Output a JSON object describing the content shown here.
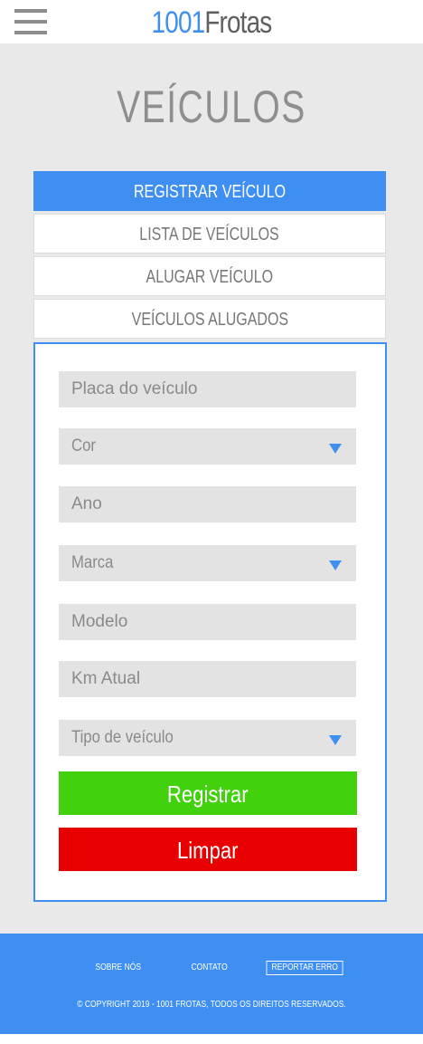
{
  "header": {
    "logo_number": "1001",
    "logo_name": "Frotas",
    "menu_icon": "hamburger-menu-icon"
  },
  "main": {
    "title": "VEÍCULOS",
    "tabs": [
      {
        "label": "REGISTRAR VEÍCULO",
        "active": true
      },
      {
        "label": "LISTA DE VEÍCULOS",
        "active": false
      },
      {
        "label": "ALUGAR VEÍCULO",
        "active": false
      },
      {
        "label": "VEÍCULOS ALUGADOS",
        "active": false
      }
    ]
  },
  "form": {
    "plate_placeholder": "Placa do veículo",
    "color_select": "Cor",
    "year_placeholder": "Ano",
    "brand_select": "Marca",
    "model_placeholder": "Modelo",
    "km_placeholder": "Km Atual",
    "type_select": "Tipo de veículo",
    "submit_label": "Registrar",
    "clear_label": "Limpar"
  },
  "footer": {
    "about": "SOBRE NÓS",
    "contact": "CONTATO",
    "report": "REPORTAR ERRO",
    "copyright": "© COPYRIGHT 2019 - 1001 FROTAS, TODOS OS DIREITOS RESERVADOS."
  },
  "colors": {
    "accent": "#3f8ff2",
    "submit": "#41d10d",
    "clear": "#e80000",
    "background": "#e9e9e9"
  }
}
